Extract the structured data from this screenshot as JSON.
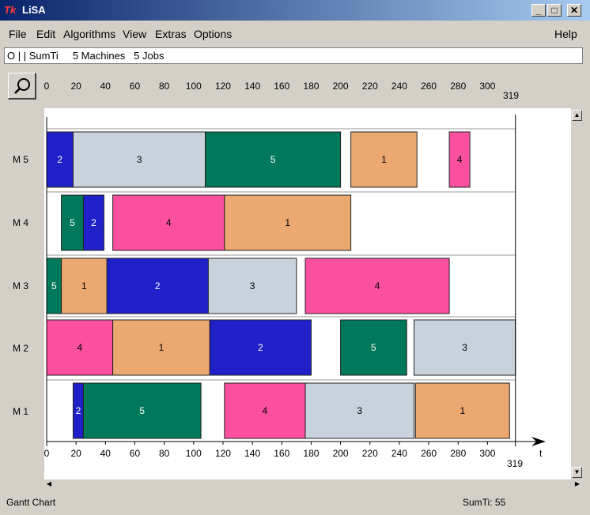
{
  "window": {
    "title": "LiSA",
    "icon": "tk-feather-icon"
  },
  "menu": {
    "items": [
      "File",
      "Edit",
      "Algorithms",
      "View",
      "Extras",
      "Options"
    ],
    "help": "Help"
  },
  "problem": {
    "text": "O | | SumTi     5 Machines   5 Jobs"
  },
  "toolbar": {
    "zoom_icon": "magnifier-icon"
  },
  "colors": {
    "job1": "#eba870",
    "job2": "#2020c8",
    "job3": "#c8d2dc",
    "job4": "#fb4fa0",
    "job5": "#00785a"
  },
  "chart_data": {
    "type": "gantt",
    "xlabel": "t",
    "xmax_label": "319",
    "xticks": [
      0,
      20,
      40,
      60,
      80,
      100,
      120,
      140,
      160,
      180,
      200,
      220,
      240,
      260,
      280,
      300
    ],
    "xrange": [
      0,
      319
    ],
    "machines": [
      "M 5",
      "M 4",
      "M 3",
      "M 2",
      "M 1"
    ],
    "operations": [
      {
        "machine": "M 5",
        "job": "2",
        "start": 0,
        "end": 18
      },
      {
        "machine": "M 5",
        "job": "3",
        "start": 18,
        "end": 108
      },
      {
        "machine": "M 5",
        "job": "5",
        "start": 108,
        "end": 200
      },
      {
        "machine": "M 5",
        "job": "1",
        "start": 207,
        "end": 252
      },
      {
        "machine": "M 5",
        "job": "4",
        "start": 274,
        "end": 288
      },
      {
        "machine": "M 4",
        "job": "5",
        "start": 10,
        "end": 25
      },
      {
        "machine": "M 4",
        "job": "2",
        "start": 25,
        "end": 39
      },
      {
        "machine": "M 4",
        "job": "4",
        "start": 45,
        "end": 121
      },
      {
        "machine": "M 4",
        "job": "1",
        "start": 121,
        "end": 207
      },
      {
        "machine": "M 3",
        "job": "5",
        "start": 0,
        "end": 10
      },
      {
        "machine": "M 3",
        "job": "1",
        "start": 10,
        "end": 41
      },
      {
        "machine": "M 3",
        "job": "2",
        "start": 41,
        "end": 110
      },
      {
        "machine": "M 3",
        "job": "3",
        "start": 110,
        "end": 170
      },
      {
        "machine": "M 3",
        "job": "4",
        "start": 176,
        "end": 274
      },
      {
        "machine": "M 2",
        "job": "4",
        "start": 0,
        "end": 45
      },
      {
        "machine": "M 2",
        "job": "1",
        "start": 45,
        "end": 111
      },
      {
        "machine": "M 2",
        "job": "2",
        "start": 111,
        "end": 180
      },
      {
        "machine": "M 2",
        "job": "5",
        "start": 200,
        "end": 245
      },
      {
        "machine": "M 2",
        "job": "3",
        "start": 250,
        "end": 319
      },
      {
        "machine": "M 1",
        "job": "2",
        "start": 18,
        "end": 25
      },
      {
        "machine": "M 1",
        "job": "5",
        "start": 25,
        "end": 105
      },
      {
        "machine": "M 1",
        "job": "4",
        "start": 121,
        "end": 176
      },
      {
        "machine": "M 1",
        "job": "3",
        "start": 176,
        "end": 250
      },
      {
        "machine": "M 1",
        "job": "1",
        "start": 251,
        "end": 315
      }
    ]
  },
  "status": {
    "left": "Gantt Chart",
    "right": "SumTi: 55"
  }
}
